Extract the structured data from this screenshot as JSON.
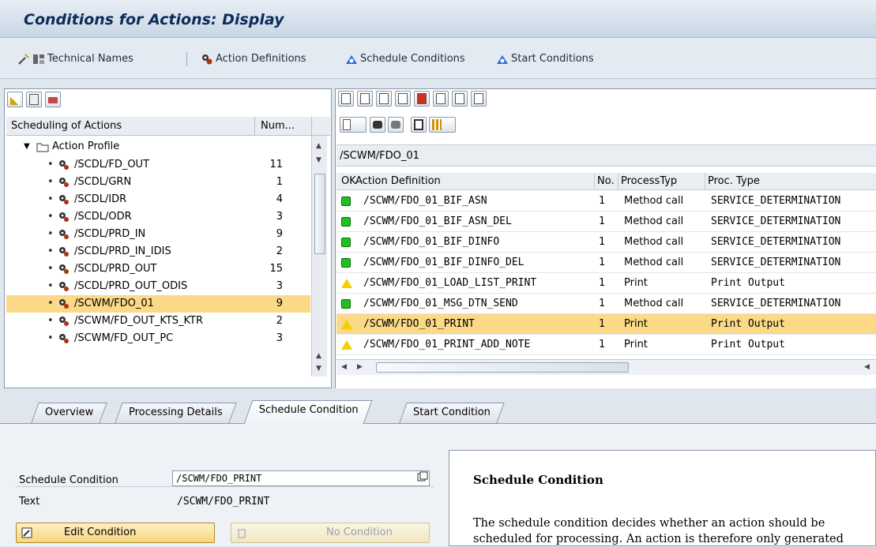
{
  "title": "Conditions for Actions: Display",
  "app_toolbar": {
    "technical_names": "Technical Names",
    "action_definitions": "Action Definitions",
    "schedule_conditions": "Schedule Conditions",
    "start_conditions": "Start Conditions"
  },
  "tree": {
    "col_scheduling": "Scheduling of Actions",
    "col_num": "Num...",
    "root_label": "Action Profile",
    "items": [
      {
        "name": "/SCDL/FD_OUT",
        "num": "11"
      },
      {
        "name": "/SCDL/GRN",
        "num": "1"
      },
      {
        "name": "/SCDL/IDR",
        "num": "4"
      },
      {
        "name": "/SCDL/ODR",
        "num": "3"
      },
      {
        "name": "/SCDL/PRD_IN",
        "num": "9"
      },
      {
        "name": "/SCDL/PRD_IN_IDIS",
        "num": "2"
      },
      {
        "name": "/SCDL/PRD_OUT",
        "num": "15"
      },
      {
        "name": "/SCDL/PRD_OUT_ODIS",
        "num": "3"
      },
      {
        "name": "/SCWM/FDO_01",
        "num": "9"
      },
      {
        "name": "/SCWM/FD_OUT_KTS_KTR",
        "num": "2"
      },
      {
        "name": "/SCWM/FD_OUT_PC",
        "num": "3"
      }
    ]
  },
  "actions": {
    "profile": "/SCWM/FDO_01",
    "col_ok": "OK",
    "col_action_definition": "Action Definition",
    "col_no": "No.",
    "col_processtyp": "ProcessTyp",
    "col_proc_type": "Proc. Type",
    "rows": [
      {
        "status": "green",
        "definition": "/SCWM/FDO_01_BIF_ASN",
        "no": "1",
        "processtyp": "Method call",
        "proc_type": "SERVICE_DETERMINATION"
      },
      {
        "status": "green",
        "definition": "/SCWM/FDO_01_BIF_ASN_DEL",
        "no": "1",
        "processtyp": "Method call",
        "proc_type": "SERVICE_DETERMINATION"
      },
      {
        "status": "green",
        "definition": "/SCWM/FDO_01_BIF_DINFO",
        "no": "1",
        "processtyp": "Method call",
        "proc_type": "SERVICE_DETERMINATION"
      },
      {
        "status": "green",
        "definition": "/SCWM/FDO_01_BIF_DINFO_DEL",
        "no": "1",
        "processtyp": "Method call",
        "proc_type": "SERVICE_DETERMINATION"
      },
      {
        "status": "yellow",
        "definition": "/SCWM/FDO_01_LOAD_LIST_PRINT",
        "no": "1",
        "processtyp": "Print",
        "proc_type": "Print Output"
      },
      {
        "status": "green",
        "definition": "/SCWM/FDO_01_MSG_DTN_SEND",
        "no": "1",
        "processtyp": "Method call",
        "proc_type": "SERVICE_DETERMINATION"
      },
      {
        "status": "yellow",
        "definition": "/SCWM/FDO_01_PRINT",
        "no": "1",
        "processtyp": "Print",
        "proc_type": "Print Output"
      },
      {
        "status": "yellow",
        "definition": "/SCWM/FDO_01_PRINT_ADD_NOTE",
        "no": "1",
        "processtyp": "Print",
        "proc_type": "Print Output"
      }
    ]
  },
  "tabs": {
    "overview": "Overview",
    "processing_details": "Processing Details",
    "schedule_condition": "Schedule Condition",
    "start_condition": "Start Condition"
  },
  "schedule_form": {
    "label_schedule_condition": "Schedule Condition",
    "value_schedule_condition": "/SCWM/FDO_PRINT",
    "label_text": "Text",
    "value_text": "/SCWM/FDO_PRINT",
    "edit_button": "Edit Condition",
    "no_condition_button": "No Condition"
  },
  "help": {
    "title": "Schedule Condition",
    "body": "The schedule condition decides whether an action should be scheduled for processing. An action is therefore only generated"
  },
  "colors": {
    "selection": "#fbd987",
    "title_text": "#0b2d5c",
    "status_green": "#21c021",
    "status_yellow": "#f5d000"
  }
}
